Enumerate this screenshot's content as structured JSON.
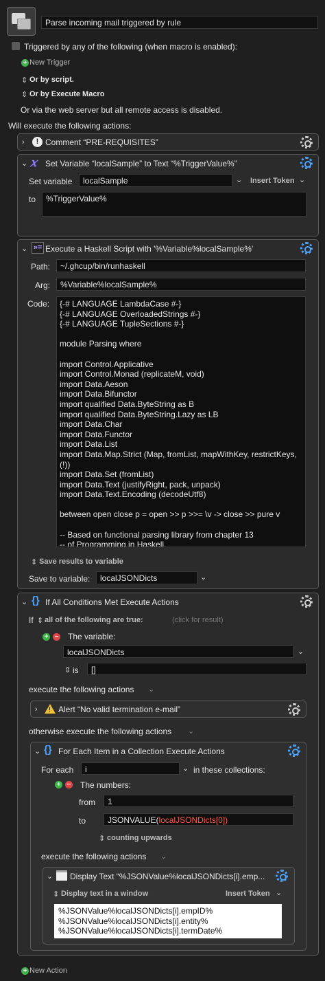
{
  "macro": {
    "name": "Parse incoming mail triggered by rule",
    "trigger_label": "Triggered by any of the following (when macro is enabled):",
    "new_trigger": "New Trigger",
    "or_by_script": "Or by script.",
    "or_by_execute_macro": "Or by Execute Macro",
    "web_server_note": "Or via the web server but all remote access is disabled.",
    "will_execute": "Will execute the following actions:",
    "new_action": "New Action"
  },
  "actions": {
    "comment": {
      "title": "Comment “PRE-REQUISITES”"
    },
    "set_variable": {
      "title": "Set Variable “localSample” to Text “%TriggerValue%”",
      "set_variable_label": "Set variable",
      "variable_value": "localSample",
      "insert_token": "Insert Token",
      "to_label": "to",
      "to_value": "%TriggerValue%"
    },
    "haskell": {
      "title": "Execute a Haskell Script with '%Variable%localSample%'",
      "path_label": "Path:",
      "path_value": "~/.ghcup/bin/runhaskell",
      "arg_label": "Arg:",
      "arg_value": "%Variable%localSample%",
      "code_label": "Code:",
      "code_lines": [
        "{-# LANGUAGE LambdaCase #-}",
        "{-# LANGUAGE OverloadedStrings #-}",
        "{-# LANGUAGE TupleSections #-}",
        "",
        "module Parsing where",
        "",
        "import Control.Applicative",
        "import Control.Monad (replicateM, void)",
        "import Data.Aeson",
        "import Data.Bifunctor",
        "import qualified Data.ByteString as B",
        "import qualified Data.ByteString.Lazy as LB",
        "import Data.Char",
        "import Data.Functor",
        "import Data.List",
        "import Data.Map.Strict (Map, fromList, mapWithKey, restrictKeys,",
        "(!))",
        "import Data.Set (fromList)",
        "import Data.Text (justifyRight, pack, unpack)",
        "import Data.Text.Encoding (decodeUtf8)",
        "",
        "between open close p = open >> p >>= \\v -> close >> pure v",
        "",
        "-- Based on functional parsing library from chapter 13",
        "-- of Programming in Haskell,"
      ],
      "save_results": "Save results to variable",
      "save_to_label": "Save to variable:",
      "save_to_value": "localJSONDicts"
    },
    "if_block": {
      "title": "If All Conditions Met Execute Actions",
      "if_label": "If",
      "all_following": "all of the following are true:",
      "click_for_result": "(click for result)",
      "the_variable": "The variable:",
      "variable_value": "localJSONDicts",
      "is_label": "is",
      "is_value": "[]",
      "execute_following": "execute the following actions",
      "alert_title": "Alert “No valid termination e-mail”",
      "otherwise": "otherwise execute the following actions"
    },
    "for_each": {
      "title": "For Each Item in a Collection Execute Actions",
      "for_each_label": "For each",
      "for_each_value": "i",
      "in_collections": "in these collections:",
      "the_numbers": "The numbers:",
      "from_label": "from",
      "from_value": "1",
      "to_label": "to",
      "to_value_prefix": "JSONVALUE(",
      "to_value_red": "localJSONDicts[0])",
      "counting": "counting upwards",
      "execute_following": "execute the following actions"
    },
    "display_text": {
      "title": "Display Text “%JSONValue%localJSONDicts[i].emp...",
      "mode": "Display text in a window",
      "insert_token": "Insert Token",
      "lines": [
        "%JSONValue%localJSONDicts[i].empID%",
        "%JSONValue%localJSONDicts[i].entity%",
        "%JSONValue%localJSONDicts[i].termDate%"
      ]
    }
  },
  "colors": {
    "accent_blue": "#4ba3ff",
    "add_green": "#3fb54a",
    "remove_red": "#e04848",
    "token_red": "#ff5a4d"
  }
}
